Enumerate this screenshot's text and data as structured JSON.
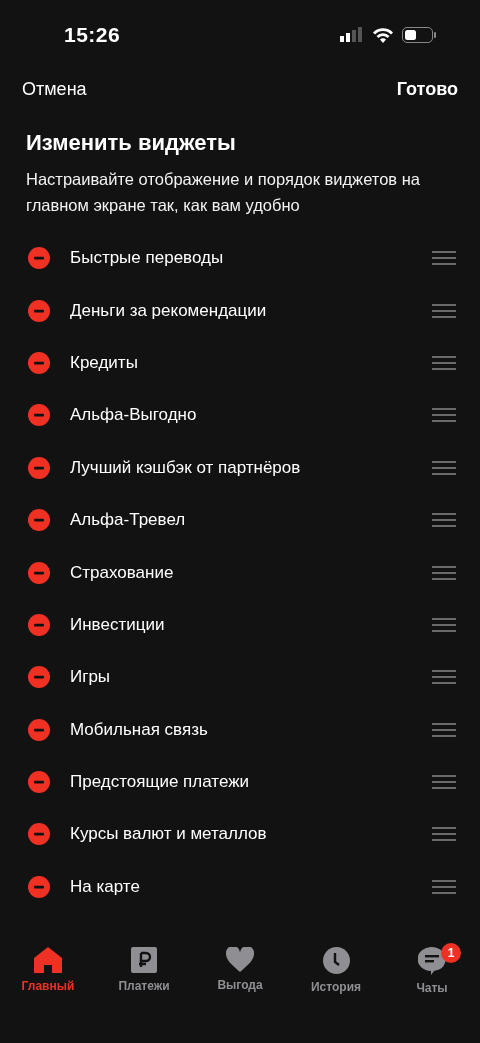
{
  "status_bar": {
    "time": "15:26"
  },
  "nav": {
    "cancel": "Отмена",
    "done": "Готово"
  },
  "title": "Изменить виджеты",
  "subtitle": "Настраивайте отображение и порядок виджетов на главном экране так, как вам удобно",
  "widgets": [
    {
      "label": "Быстрые переводы"
    },
    {
      "label": "Деньги за рекомендации"
    },
    {
      "label": "Кредиты"
    },
    {
      "label": "Альфа-Выгодно"
    },
    {
      "label": "Лучший кэшбэк от партнёров"
    },
    {
      "label": "Альфа-Тревел"
    },
    {
      "label": "Страхование"
    },
    {
      "label": "Инвестиции"
    },
    {
      "label": "Игры"
    },
    {
      "label": "Мобильная связь"
    },
    {
      "label": "Предстоящие платежи"
    },
    {
      "label": "Курсы валют и металлов"
    },
    {
      "label": "На карте"
    }
  ],
  "tab_bar": [
    {
      "label": "Главный",
      "selected": true
    },
    {
      "label": "Платежи",
      "selected": false
    },
    {
      "label": "Выгода",
      "selected": false
    },
    {
      "label": "История",
      "selected": false
    },
    {
      "label": "Чаты",
      "selected": false,
      "badge": "1"
    }
  ]
}
